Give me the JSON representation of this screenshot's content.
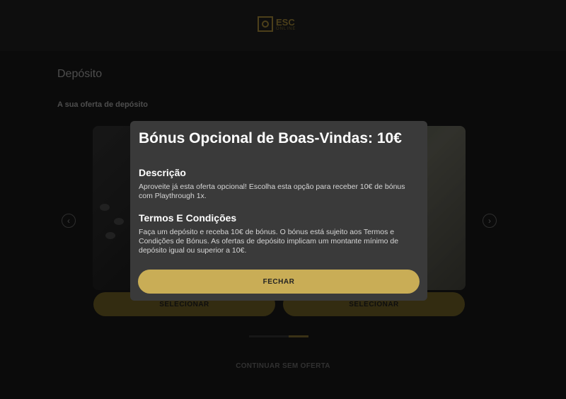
{
  "header": {
    "logo_line1": "ESC",
    "logo_line2": "ONLINE"
  },
  "page": {
    "title": "Depósito",
    "offer_section_title": "A sua oferta de depósito"
  },
  "cards": [
    {
      "select_label": "SELECIONAR"
    },
    {
      "select_label": "SELECIONAR"
    }
  ],
  "carousel": {
    "prev_icon": "‹",
    "next_icon": "›"
  },
  "continue_label": "CONTINUAR SEM OFERTA",
  "modal": {
    "title": "Bónus Opcional de Boas-Vindas: 10€",
    "description_heading": "Descrição",
    "description_text": "Aproveite já esta oferta opcional! Escolha esta opção para receber 10€ de bónus com Playthrough 1x.",
    "terms_heading": "Termos E Condições",
    "terms_text": "Faça um depósito e receba 10€ de bónus. O bónus está sujeito aos Termos e Condições de Bónus. As ofertas de depósito implicam um montante mínimo de depósito igual ou superior a 10€.",
    "close_label": "FECHAR"
  },
  "colors": {
    "accent": "#c9ad56",
    "modal_bg": "#3a3a3a",
    "page_bg": "#141414"
  }
}
